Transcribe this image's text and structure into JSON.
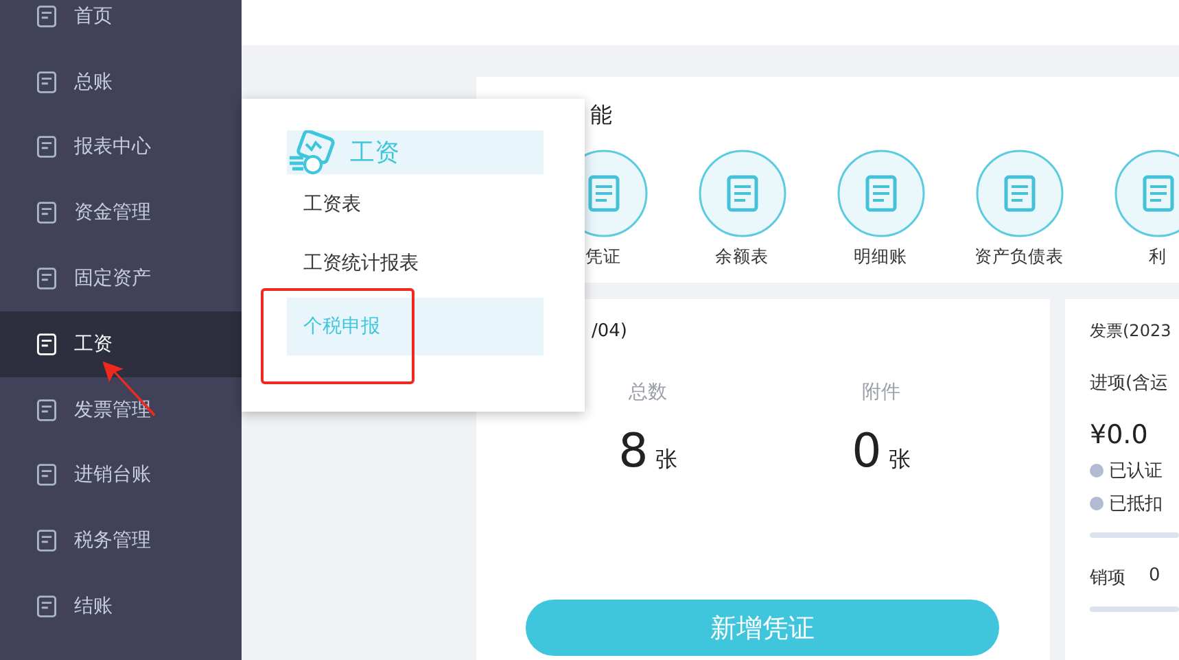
{
  "sidebar": {
    "items": [
      {
        "label": "首页",
        "selected": false
      },
      {
        "label": "总账",
        "selected": false
      },
      {
        "label": "报表中心",
        "selected": false
      },
      {
        "label": "资金管理",
        "selected": false
      },
      {
        "label": "固定资产",
        "selected": false
      },
      {
        "label": "工资",
        "selected": true
      },
      {
        "label": "发票管理",
        "selected": false
      },
      {
        "label": "进销台账",
        "selected": false
      },
      {
        "label": "税务管理",
        "selected": false
      },
      {
        "label": "结账",
        "selected": false
      }
    ]
  },
  "submenu": {
    "title": "工资",
    "items": [
      {
        "label": "工资表",
        "selected": false
      },
      {
        "label": "工资统计报表",
        "selected": false
      },
      {
        "label": "个税申报",
        "selected": true
      }
    ]
  },
  "shortcuts": {
    "title": "能",
    "items": [
      "凭证",
      "余额表",
      "明细账",
      "资产负债表",
      "利"
    ]
  },
  "voucher_card": {
    "title": "/04)",
    "stats": [
      {
        "label": "总数",
        "value": "8",
        "unit": "张"
      },
      {
        "label": "附件",
        "value": "0",
        "unit": "张"
      }
    ],
    "button": "新增凭证"
  },
  "invoice_card": {
    "title": "发票(2023",
    "input_label": "进项(含运",
    "amount": "¥0.0",
    "statuses": [
      "已认证",
      "已抵扣"
    ],
    "output_label": "销项",
    "output_value": "0"
  }
}
